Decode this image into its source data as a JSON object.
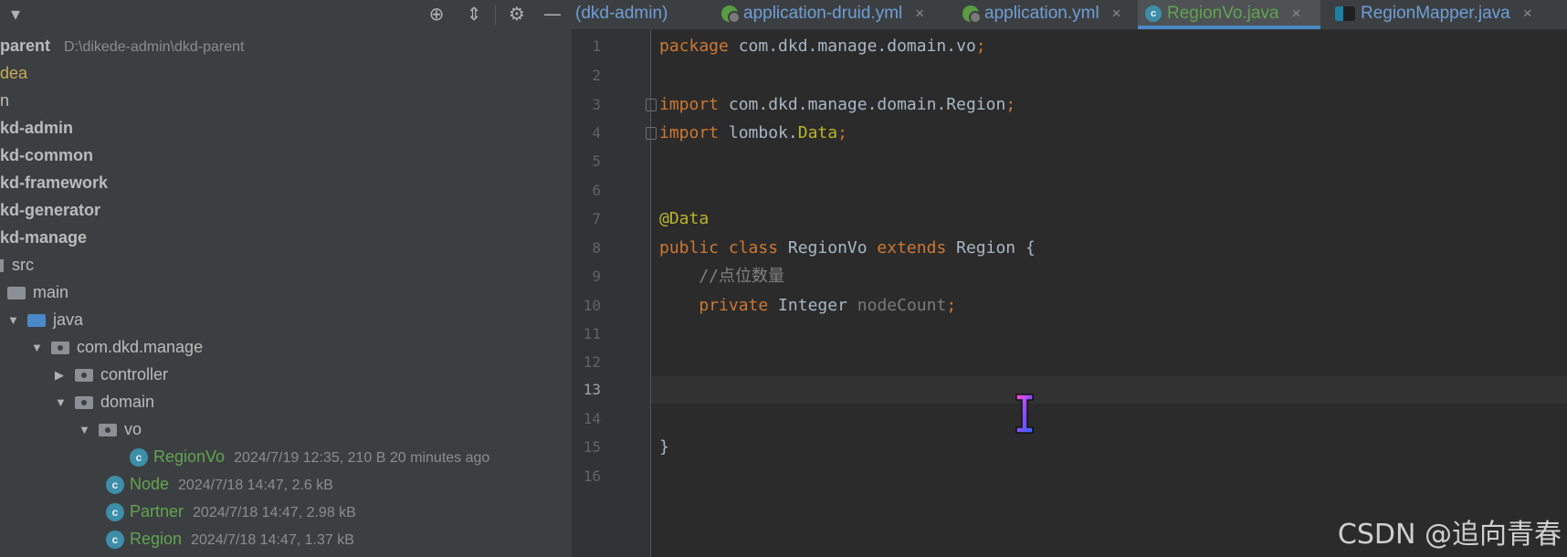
{
  "project_panel": {
    "toolbar_icons": [
      "dropdown-icon",
      "locate-icon",
      "collapse-icon",
      "gear-icon",
      "minimize-icon"
    ],
    "tree": [
      {
        "text": "parent",
        "meta": "D:\\dikede-admin\\dkd-parent"
      },
      {
        "text": "dea"
      },
      {
        "text": "n"
      },
      {
        "text": "kd-admin"
      },
      {
        "text": "kd-common"
      },
      {
        "text": "kd-framework"
      },
      {
        "text": "kd-generator"
      },
      {
        "text": "kd-manage"
      },
      {
        "text": "src"
      },
      {
        "text": "main"
      },
      {
        "text": "java"
      },
      {
        "text": "com.dkd.manage"
      },
      {
        "text": "controller"
      },
      {
        "text": "domain"
      },
      {
        "text": "vo"
      },
      {
        "text": "RegionVo",
        "meta": "2024/7/19 12:35, 210 B 20 minutes ago"
      },
      {
        "text": "Node",
        "meta": "2024/7/18 14:47, 2.6 kB"
      },
      {
        "text": "Partner",
        "meta": "2024/7/18 14:47, 2.98 kB"
      },
      {
        "text": "Region",
        "meta": "2024/7/18 14:47, 1.37 kB"
      }
    ]
  },
  "tabs": [
    {
      "label": "(dkd-admin)"
    },
    {
      "label": "application-druid.yml",
      "close": "×"
    },
    {
      "label": "application.yml",
      "close": "×"
    },
    {
      "label": "RegionVo.java",
      "close": "×",
      "active": true
    },
    {
      "label": "RegionMapper.java",
      "close": "×"
    }
  ],
  "editor": {
    "line_numbers": [
      "1",
      "2",
      "3",
      "4",
      "5",
      "6",
      "7",
      "8",
      "9",
      "10",
      "11",
      "12",
      "13",
      "14",
      "15",
      "16"
    ],
    "current_line": "13",
    "code": {
      "l1_kw": "package",
      "l1_rest": " com.dkd.manage.domain.vo",
      "l1_semi": ";",
      "l3_kw": "import",
      "l3_rest": " com.dkd.manage.domain.Region",
      "l3_semi": ";",
      "l4_kw": "import",
      "l4_rest": " lombok.",
      "l4_data": "Data",
      "l4_semi": ";",
      "l7_ann": "@Data",
      "l8_kw1": "public class",
      "l8_name": " RegionVo ",
      "l8_kw2": "extends",
      "l8_rest": " Region {",
      "l9_cmt": "    //点位数量",
      "l10_kw": "    private",
      "l10_type": " Integer ",
      "l10_field": "nodeCount",
      "l10_semi": ";",
      "l15": "}"
    }
  },
  "watermark": "CSDN @追向青春",
  "colors": {
    "keyword": "#cc7832",
    "annotation": "#bbb529",
    "comment": "#808080",
    "class_icon": "#3d8ea8",
    "green_file": "#62a352",
    "tab_text": "#6f9ed6",
    "active_tab_underline": "#4a88c7"
  }
}
